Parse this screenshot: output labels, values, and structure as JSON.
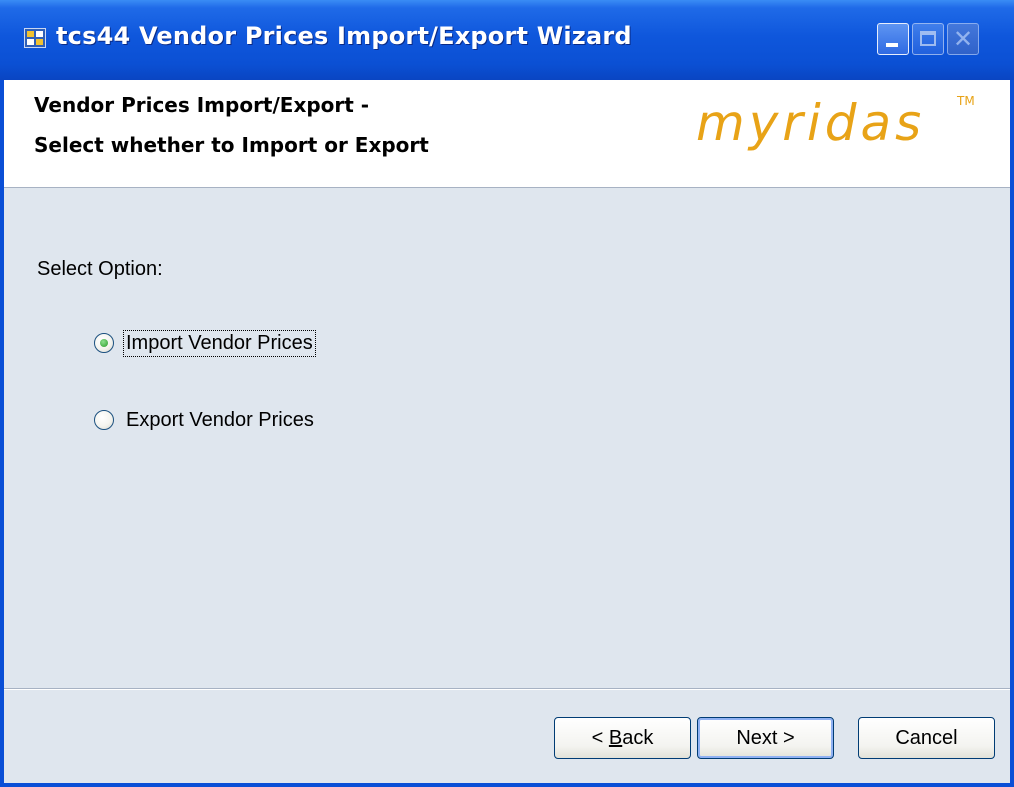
{
  "window": {
    "title": "tcs44 Vendor Prices Import/Export Wizard",
    "controls": {
      "minimize": "_",
      "maximize": "□",
      "close": "✕"
    },
    "app_icon": "wizard-window-icon"
  },
  "header": {
    "line1": "Vendor Prices Import/Export -",
    "line2": "Select whether to Import or Export",
    "logo_text": "myridas",
    "logo_tm": "TM",
    "logo_color": "#e8a317"
  },
  "main": {
    "select_label": "Select Option:",
    "options": [
      {
        "label": "Import Vendor Prices",
        "selected": true
      },
      {
        "label": "Export Vendor Prices",
        "selected": false
      }
    ]
  },
  "footer": {
    "back_prefix": "< ",
    "back_mnemonic": "B",
    "back_rest": "ack",
    "next_label": "Next >",
    "cancel_label": "Cancel"
  },
  "colors": {
    "titlebar": "#0a4fd6",
    "client_bg": "#dfe6ee",
    "radio_selected": "#2a9b2a"
  }
}
